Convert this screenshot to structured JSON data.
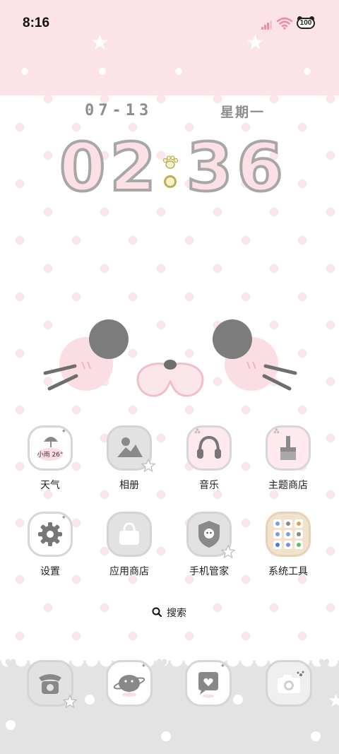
{
  "status_bar": {
    "time": "8:16",
    "battery_level": "100",
    "signal_icon": "signal-bars-icon",
    "wifi_icon": "wifi-icon",
    "battery_icon": "cat-battery-icon"
  },
  "widget": {
    "date": "07-13",
    "weekday": "星期一",
    "clock_hours": "02",
    "clock_minutes": "36",
    "separator_icon": "paw-icon"
  },
  "apps": [
    {
      "label": "天气",
      "icon": "weather-icon",
      "weather_text": "小雨 26°"
    },
    {
      "label": "相册",
      "icon": "gallery-icon"
    },
    {
      "label": "音乐",
      "icon": "headphones-icon"
    },
    {
      "label": "主题商店",
      "icon": "brush-icon"
    },
    {
      "label": "设置",
      "icon": "gear-icon"
    },
    {
      "label": "应用商店",
      "icon": "shopping-bag-icon"
    },
    {
      "label": "手机管家",
      "icon": "shield-icon"
    },
    {
      "label": "系统工具",
      "icon": "folder-icon"
    }
  ],
  "search": {
    "label": "搜索",
    "icon": "search-icon"
  },
  "dock": [
    {
      "icon": "phone-icon"
    },
    {
      "icon": "messages-icon"
    },
    {
      "icon": "chat-heart-icon"
    },
    {
      "icon": "camera-icon"
    }
  ],
  "colors": {
    "wallpaper_dot": "#fbe6ea",
    "top_band": "#fbe3e8",
    "clock_fill": "#fbe0e6",
    "clock_stroke": "#a7a7a7",
    "dock_band": "#e3e3e3",
    "accent_pink": "#ea8fa4"
  }
}
